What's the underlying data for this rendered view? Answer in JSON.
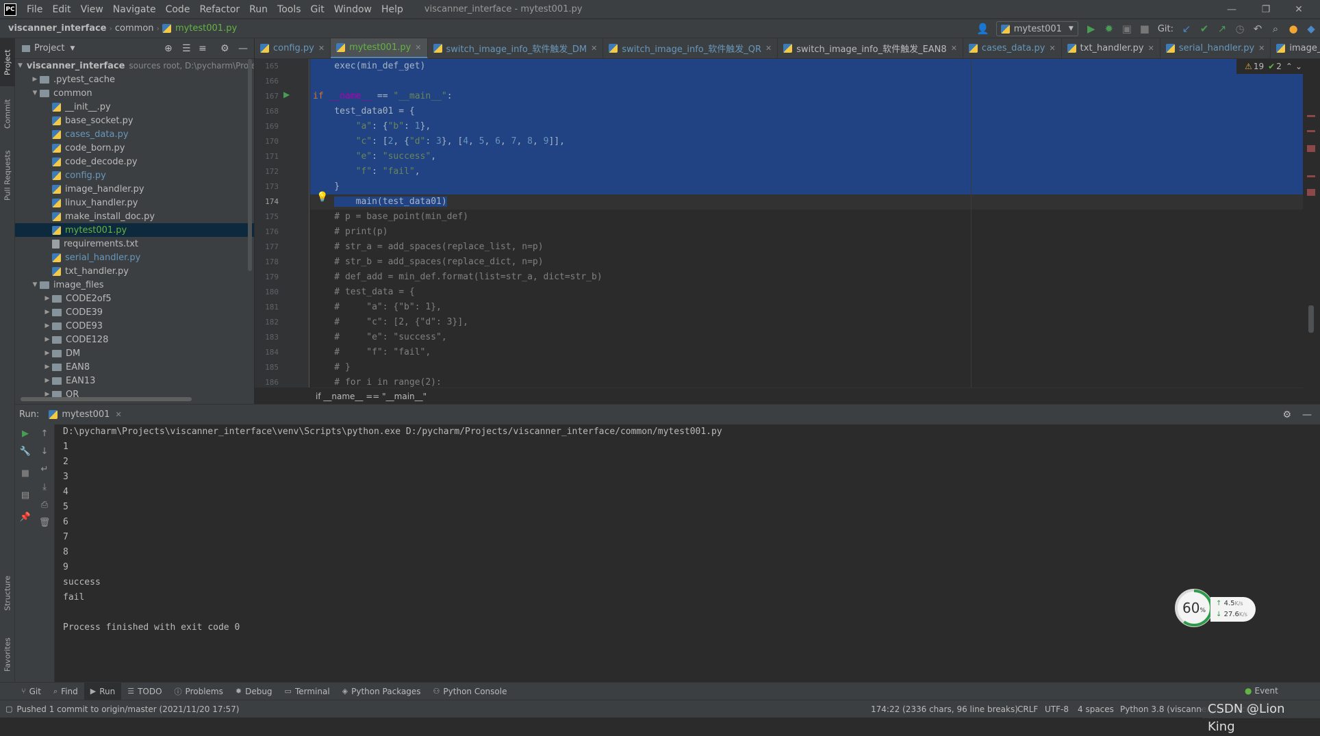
{
  "menubar": {
    "logo": "PC",
    "items": [
      "File",
      "Edit",
      "View",
      "Navigate",
      "Code",
      "Refactor",
      "Run",
      "Tools",
      "Git",
      "Window",
      "Help"
    ],
    "window_title": "viscanner_interface - mytest001.py"
  },
  "navbar": {
    "crumbs": [
      "viscanner_interface",
      "common",
      "mytest001.py"
    ],
    "run_config": "mytest001",
    "git_label": "Git:"
  },
  "left_strip": {
    "tabs": [
      "Project",
      "Commit",
      "Pull Requests",
      "Structure",
      "Favorites"
    ]
  },
  "project_panel": {
    "title": "Project",
    "root": {
      "name": "viscanner_interface",
      "hint": "sources root, D:\\pycharm\\Proje"
    },
    "tree": [
      {
        "label": ".pytest_cache",
        "kind": "folder",
        "depth": 1,
        "arrow": "▶"
      },
      {
        "label": "common",
        "kind": "folder",
        "depth": 1,
        "arrow": "▼"
      },
      {
        "label": "__init__.py",
        "kind": "py",
        "depth": 2,
        "color": "#bbbbbb"
      },
      {
        "label": "base_socket.py",
        "kind": "py",
        "depth": 2,
        "color": "#bbbbbb"
      },
      {
        "label": "cases_data.py",
        "kind": "py",
        "depth": 2,
        "color": "#6897bb"
      },
      {
        "label": "code_born.py",
        "kind": "py",
        "depth": 2,
        "color": "#bbbbbb"
      },
      {
        "label": "code_decode.py",
        "kind": "py",
        "depth": 2,
        "color": "#bbbbbb"
      },
      {
        "label": "config.py",
        "kind": "py",
        "depth": 2,
        "color": "#6897bb"
      },
      {
        "label": "image_handler.py",
        "kind": "py",
        "depth": 2,
        "color": "#bbbbbb"
      },
      {
        "label": "linux_handler.py",
        "kind": "py",
        "depth": 2,
        "color": "#bbbbbb"
      },
      {
        "label": "make_install_doc.py",
        "kind": "py",
        "depth": 2,
        "color": "#bbbbbb"
      },
      {
        "label": "mytest001.py",
        "kind": "py",
        "depth": 2,
        "color": "#62b543",
        "selected": true
      },
      {
        "label": "requirements.txt",
        "kind": "txt",
        "depth": 2,
        "color": "#bbbbbb"
      },
      {
        "label": "serial_handler.py",
        "kind": "py",
        "depth": 2,
        "color": "#6897bb"
      },
      {
        "label": "txt_handler.py",
        "kind": "py",
        "depth": 2,
        "color": "#bbbbbb"
      },
      {
        "label": "image_files",
        "kind": "folder",
        "depth": 1,
        "arrow": "▼"
      },
      {
        "label": "CODE2of5",
        "kind": "folder",
        "depth": 2,
        "arrow": "▶"
      },
      {
        "label": "CODE39",
        "kind": "folder",
        "depth": 2,
        "arrow": "▶"
      },
      {
        "label": "CODE93",
        "kind": "folder",
        "depth": 2,
        "arrow": "▶"
      },
      {
        "label": "CODE128",
        "kind": "folder",
        "depth": 2,
        "arrow": "▶"
      },
      {
        "label": "DM",
        "kind": "folder",
        "depth": 2,
        "arrow": "▶"
      },
      {
        "label": "EAN8",
        "kind": "folder",
        "depth": 2,
        "arrow": "▶"
      },
      {
        "label": "EAN13",
        "kind": "folder",
        "depth": 2,
        "arrow": "▶"
      },
      {
        "label": "QR",
        "kind": "folder",
        "depth": 2,
        "arrow": "▶"
      }
    ]
  },
  "editor_tabs": [
    {
      "label": "config.py",
      "color": "#6897bb"
    },
    {
      "label": "mytest001.py",
      "color": "#62b543",
      "active": true
    },
    {
      "label": "switch_image_info_软件触发_DM",
      "color": "#6897bb"
    },
    {
      "label": "switch_image_info_软件触发_QR",
      "color": "#6897bb"
    },
    {
      "label": "switch_image_info_软件触发_EAN8",
      "color": "#bbbbbb"
    },
    {
      "label": "cases_data.py",
      "color": "#6897bb"
    },
    {
      "label": "txt_handler.py",
      "color": "#bbbbbb"
    },
    {
      "label": "serial_handler.py",
      "color": "#6897bb"
    },
    {
      "label": "image_handler.py",
      "color": "#bbbbbb"
    }
  ],
  "inspections": {
    "warnings": "19",
    "ok": "2"
  },
  "editor": {
    "line_numbers": [
      "165",
      "166",
      "167",
      "168",
      "169",
      "170",
      "171",
      "172",
      "173",
      "174",
      "175",
      "176",
      "177",
      "178",
      "179",
      "180",
      "181",
      "182",
      "183",
      "184",
      "185",
      "186"
    ],
    "current_line": "174",
    "lines": [
      "    exec(min_def_get)",
      "",
      "if __name__ == \"__main__\":",
      "    test_data01 = {",
      "        \"a\": {\"b\": 1},",
      "        \"c\": [2, {\"d\": 3}, [4, 5, 6, 7, 8, 9]],",
      "        \"e\": \"success\",",
      "        \"f\": \"fail\",",
      "    }",
      "    main(test_data01)",
      "    # p = base_point(min_def)",
      "    # print(p)",
      "    # str_a = add_spaces(replace_list, n=p)",
      "    # str_b = add_spaces(replace_dict, n=p)",
      "    # def_add = min_def.format(list=str_a, dict=str_b)",
      "    # test_data = {",
      "    #     \"a\": {\"b\": 1},",
      "    #     \"c\": [2, {\"d\": 3}],",
      "    #     \"e\": \"success\",",
      "    #     \"f\": \"fail\",",
      "    # }",
      "    # for i in range(2):"
    ],
    "bottom_breadcrumb": "if __name__ == \"__main__\""
  },
  "run_panel": {
    "label": "Run:",
    "tab": "mytest001",
    "output": [
      "D:\\pycharm\\Projects\\viscanner_interface\\venv\\Scripts\\python.exe D:/pycharm/Projects/viscanner_interface/common/mytest001.py",
      "1",
      "2",
      "3",
      "4",
      "5",
      "6",
      "7",
      "8",
      "9",
      "success",
      "fail",
      "",
      "Process finished with exit code 0"
    ]
  },
  "net_gauge": {
    "percent": "60",
    "unit": "%",
    "up": "4.5",
    "down": "27.6",
    "rate_unit": "K/s"
  },
  "bottom_tabs": [
    {
      "label": "Git",
      "icon": "branch-icon"
    },
    {
      "label": "Find",
      "icon": "search-icon"
    },
    {
      "label": "Run",
      "icon": "run-icon",
      "active": true
    },
    {
      "label": "TODO",
      "icon": "list-icon"
    },
    {
      "label": "Problems",
      "icon": "info-icon"
    },
    {
      "label": "Debug",
      "icon": "bug-icon"
    },
    {
      "label": "Terminal",
      "icon": "terminal-icon"
    },
    {
      "label": "Python Packages",
      "icon": "package-icon"
    },
    {
      "label": "Python Console",
      "icon": "python-icon"
    }
  ],
  "event_log": "Event",
  "status": {
    "message": "Pushed 1 commit to origin/master (2021/11/20 17:57)",
    "position": "174:22 (2336 chars, 96 line breaks)",
    "line_sep": "CRLF",
    "encoding": "UTF-8",
    "indent": "4 spaces",
    "interpreter": "Python 3.8 (viscanner_interface)",
    "watermark": "CSDN @Lion King"
  },
  "colors": {
    "selection": "#214283",
    "keyword": "#cc7832",
    "string": "#6a8759",
    "number": "#6897bb",
    "comment": "#808080",
    "accent": "#4a88c7"
  }
}
